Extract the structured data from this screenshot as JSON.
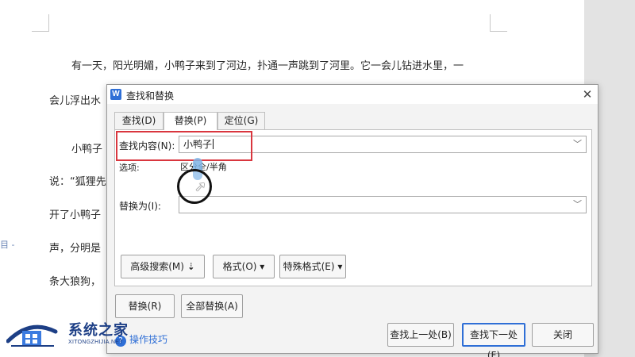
{
  "document": {
    "lines": [
      "有一天，阳光明媚，小鸭子来到了河边，扑通一声跳到了河里。它一会儿钻进水里，一",
      "会儿浮出水",
      "小鸭子",
      "说：“狐狸先",
      "开了小鸭子",
      "声，分明是",
      "条大狼狗，"
    ],
    "side_icon_label": "目 -"
  },
  "dialog": {
    "title": "查找和替换",
    "app_icon_letter": "W",
    "close_label": "✕",
    "tabs": [
      {
        "label": "查找(D)",
        "active": false
      },
      {
        "label": "替换(P)",
        "active": true
      },
      {
        "label": "定位(G)",
        "active": false
      }
    ],
    "find": {
      "label": "查找内容(N):",
      "value": "小鸭子",
      "dropdown_icon": "chevron-down-icon"
    },
    "options": {
      "label": "选项:",
      "value": "区分全/半角"
    },
    "replace": {
      "label": "替换为(I):",
      "value": "",
      "dropdown_icon": "chevron-down-icon"
    },
    "option_buttons": [
      {
        "label": "高级搜索(M) ⇣"
      },
      {
        "label": "格式(O) ▾"
      },
      {
        "label": "特殊格式(E) ▾"
      }
    ],
    "replace_button": "替换(R)",
    "replace_all_button": "全部替换(A)",
    "tips_label": "操作技巧",
    "find_prev_button": "查找上一处(B)",
    "find_next_button": "查找下一处(F)",
    "close_button": "关闭"
  },
  "watermark": {
    "title": "系统之家",
    "subtitle": "XITONGZHIJIA.NET"
  },
  "colors": {
    "accent": "#2f6fd6",
    "highlight": "#d9363e",
    "watermark": "#1d3f86"
  }
}
